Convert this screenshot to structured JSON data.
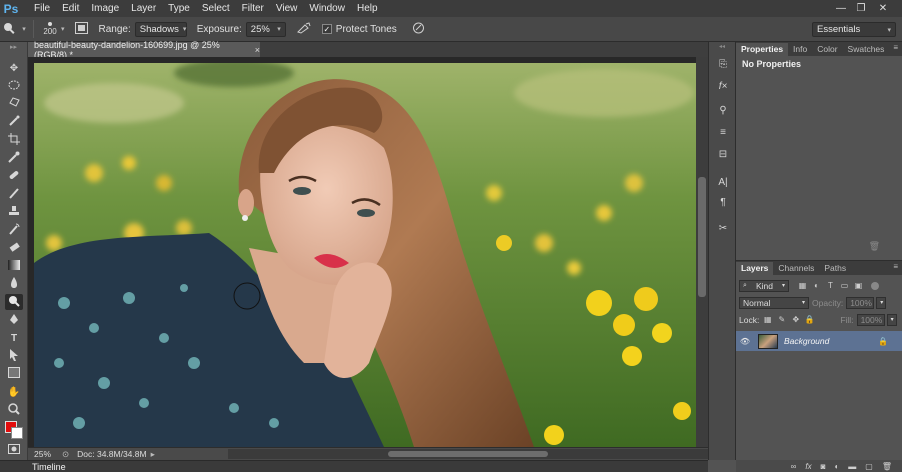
{
  "app": {
    "logo": "Ps"
  },
  "menu": [
    "File",
    "Edit",
    "Image",
    "Layer",
    "Type",
    "Select",
    "Filter",
    "View",
    "Window",
    "Help"
  ],
  "window_controls": {
    "minimize": "—",
    "restore": "❐",
    "close": "✕"
  },
  "options": {
    "brush_size": "200",
    "range_label": "Range:",
    "range_value": "Shadows",
    "exposure_label": "Exposure:",
    "exposure_value": "25%",
    "protect_tones_label": "Protect Tones",
    "protect_tones_checked": true,
    "workspace": "Essentials"
  },
  "document": {
    "tab_title": "beautiful-beauty-dandelion-160699.jpg @ 25% (RGB/8) *",
    "tab_close": "×",
    "zoom": "25%",
    "doc_info": "Doc: 34.8M/34.8M"
  },
  "timeline": {
    "label": "Timeline"
  },
  "properties_panel": {
    "tabs": [
      "Properties",
      "Info",
      "Color",
      "Swatches"
    ],
    "active_tab": "Properties",
    "message": "No Properties"
  },
  "layers_panel": {
    "tabs": [
      "Layers",
      "Channels",
      "Paths"
    ],
    "active_tab": "Layers",
    "filter_kind": "Kind",
    "blend_mode": "Normal",
    "opacity_label": "Opacity:",
    "opacity_value": "100%",
    "lock_label": "Lock:",
    "fill_label": "Fill:",
    "fill_value": "100%",
    "layers": [
      {
        "name": "Background",
        "visible": true,
        "locked": true,
        "selected": true
      }
    ]
  },
  "colors": {
    "foreground": "#e30d0d",
    "background": "#ffffff",
    "selected_layer": "#5d7293"
  },
  "tools": [
    "move-icon",
    "marquee-icon",
    "lasso-icon",
    "quick-select-icon",
    "crop-icon",
    "eyedropper-icon",
    "healing-icon",
    "brush-icon",
    "clone-stamp-icon",
    "history-brush-icon",
    "eraser-icon",
    "gradient-icon",
    "blur-icon",
    "burn-icon",
    "pen-icon",
    "type-icon",
    "path-select-icon",
    "shape-icon",
    "hand-icon",
    "zoom-icon"
  ]
}
